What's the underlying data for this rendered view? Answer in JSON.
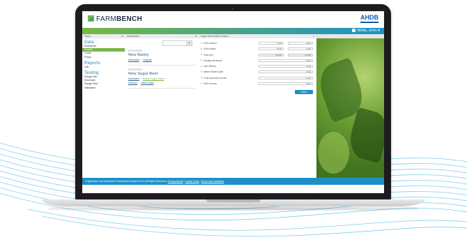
{
  "app": {
    "brand_farm": "FARM",
    "brand_bench": "BENCH",
    "partner_logo": "AHDB",
    "user_name": "Wells, John"
  },
  "navigation": {
    "header": "Tasks",
    "sections": [
      {
        "title": "Data",
        "items": [
          "Enterprise",
          "Income",
          "Costs",
          "Policy"
        ]
      },
      {
        "title": "Reports",
        "items": [
          "Lab"
        ]
      },
      {
        "title": "Testing",
        "items": [
          "Range Min",
          "Decimals",
          "Range Max",
          "Validation"
        ]
      }
    ],
    "active_item": "Income"
  },
  "list_panel": {
    "header": "Enterprises",
    "items": [
      {
        "category": "ENTERPRISE",
        "title": "New Barley",
        "links": [
          "Estimates",
          "Outputs"
        ]
      },
      {
        "category": "ENTERPRISE",
        "title": "New Sugar Beet",
        "links": [
          "Estimates",
          "British Sugar Sales"
        ],
        "links2": [
          "Delivery",
          "Other sales"
        ]
      }
    ]
  },
  "form_panel": {
    "header": "Sugar Beet Actual Output",
    "rows": [
      {
        "label": "Sold contract",
        "v1": "00.00",
        "v2": "00.00"
      },
      {
        "label": "Sold surplus",
        "v1": "00.00",
        "v2": "00.00"
      },
      {
        "label": "Total sold",
        "v1": "0.00.00",
        "v2": "0.00.00"
      },
      {
        "label": "Haulage allowance",
        "v": "00.00"
      },
      {
        "label": "Late delivery",
        "v": "00.00"
      },
      {
        "label": "Market related uplift",
        "v": "00.00"
      },
      {
        "label": "Frost insurance income",
        "v": "00.00"
      },
      {
        "label": "Other income",
        "v": "00.00"
      }
    ],
    "save_label": "Save"
  },
  "footer": {
    "copyright": "© Agriculture and Horticulture Development Board 2018 | All Rights Reserved |",
    "links": [
      "Privacy Notice",
      "Cookie Policy",
      "Terms and Conditions"
    ]
  },
  "colors": {
    "accent_green": "#7ab648",
    "accent_blue": "#1e90c8"
  }
}
